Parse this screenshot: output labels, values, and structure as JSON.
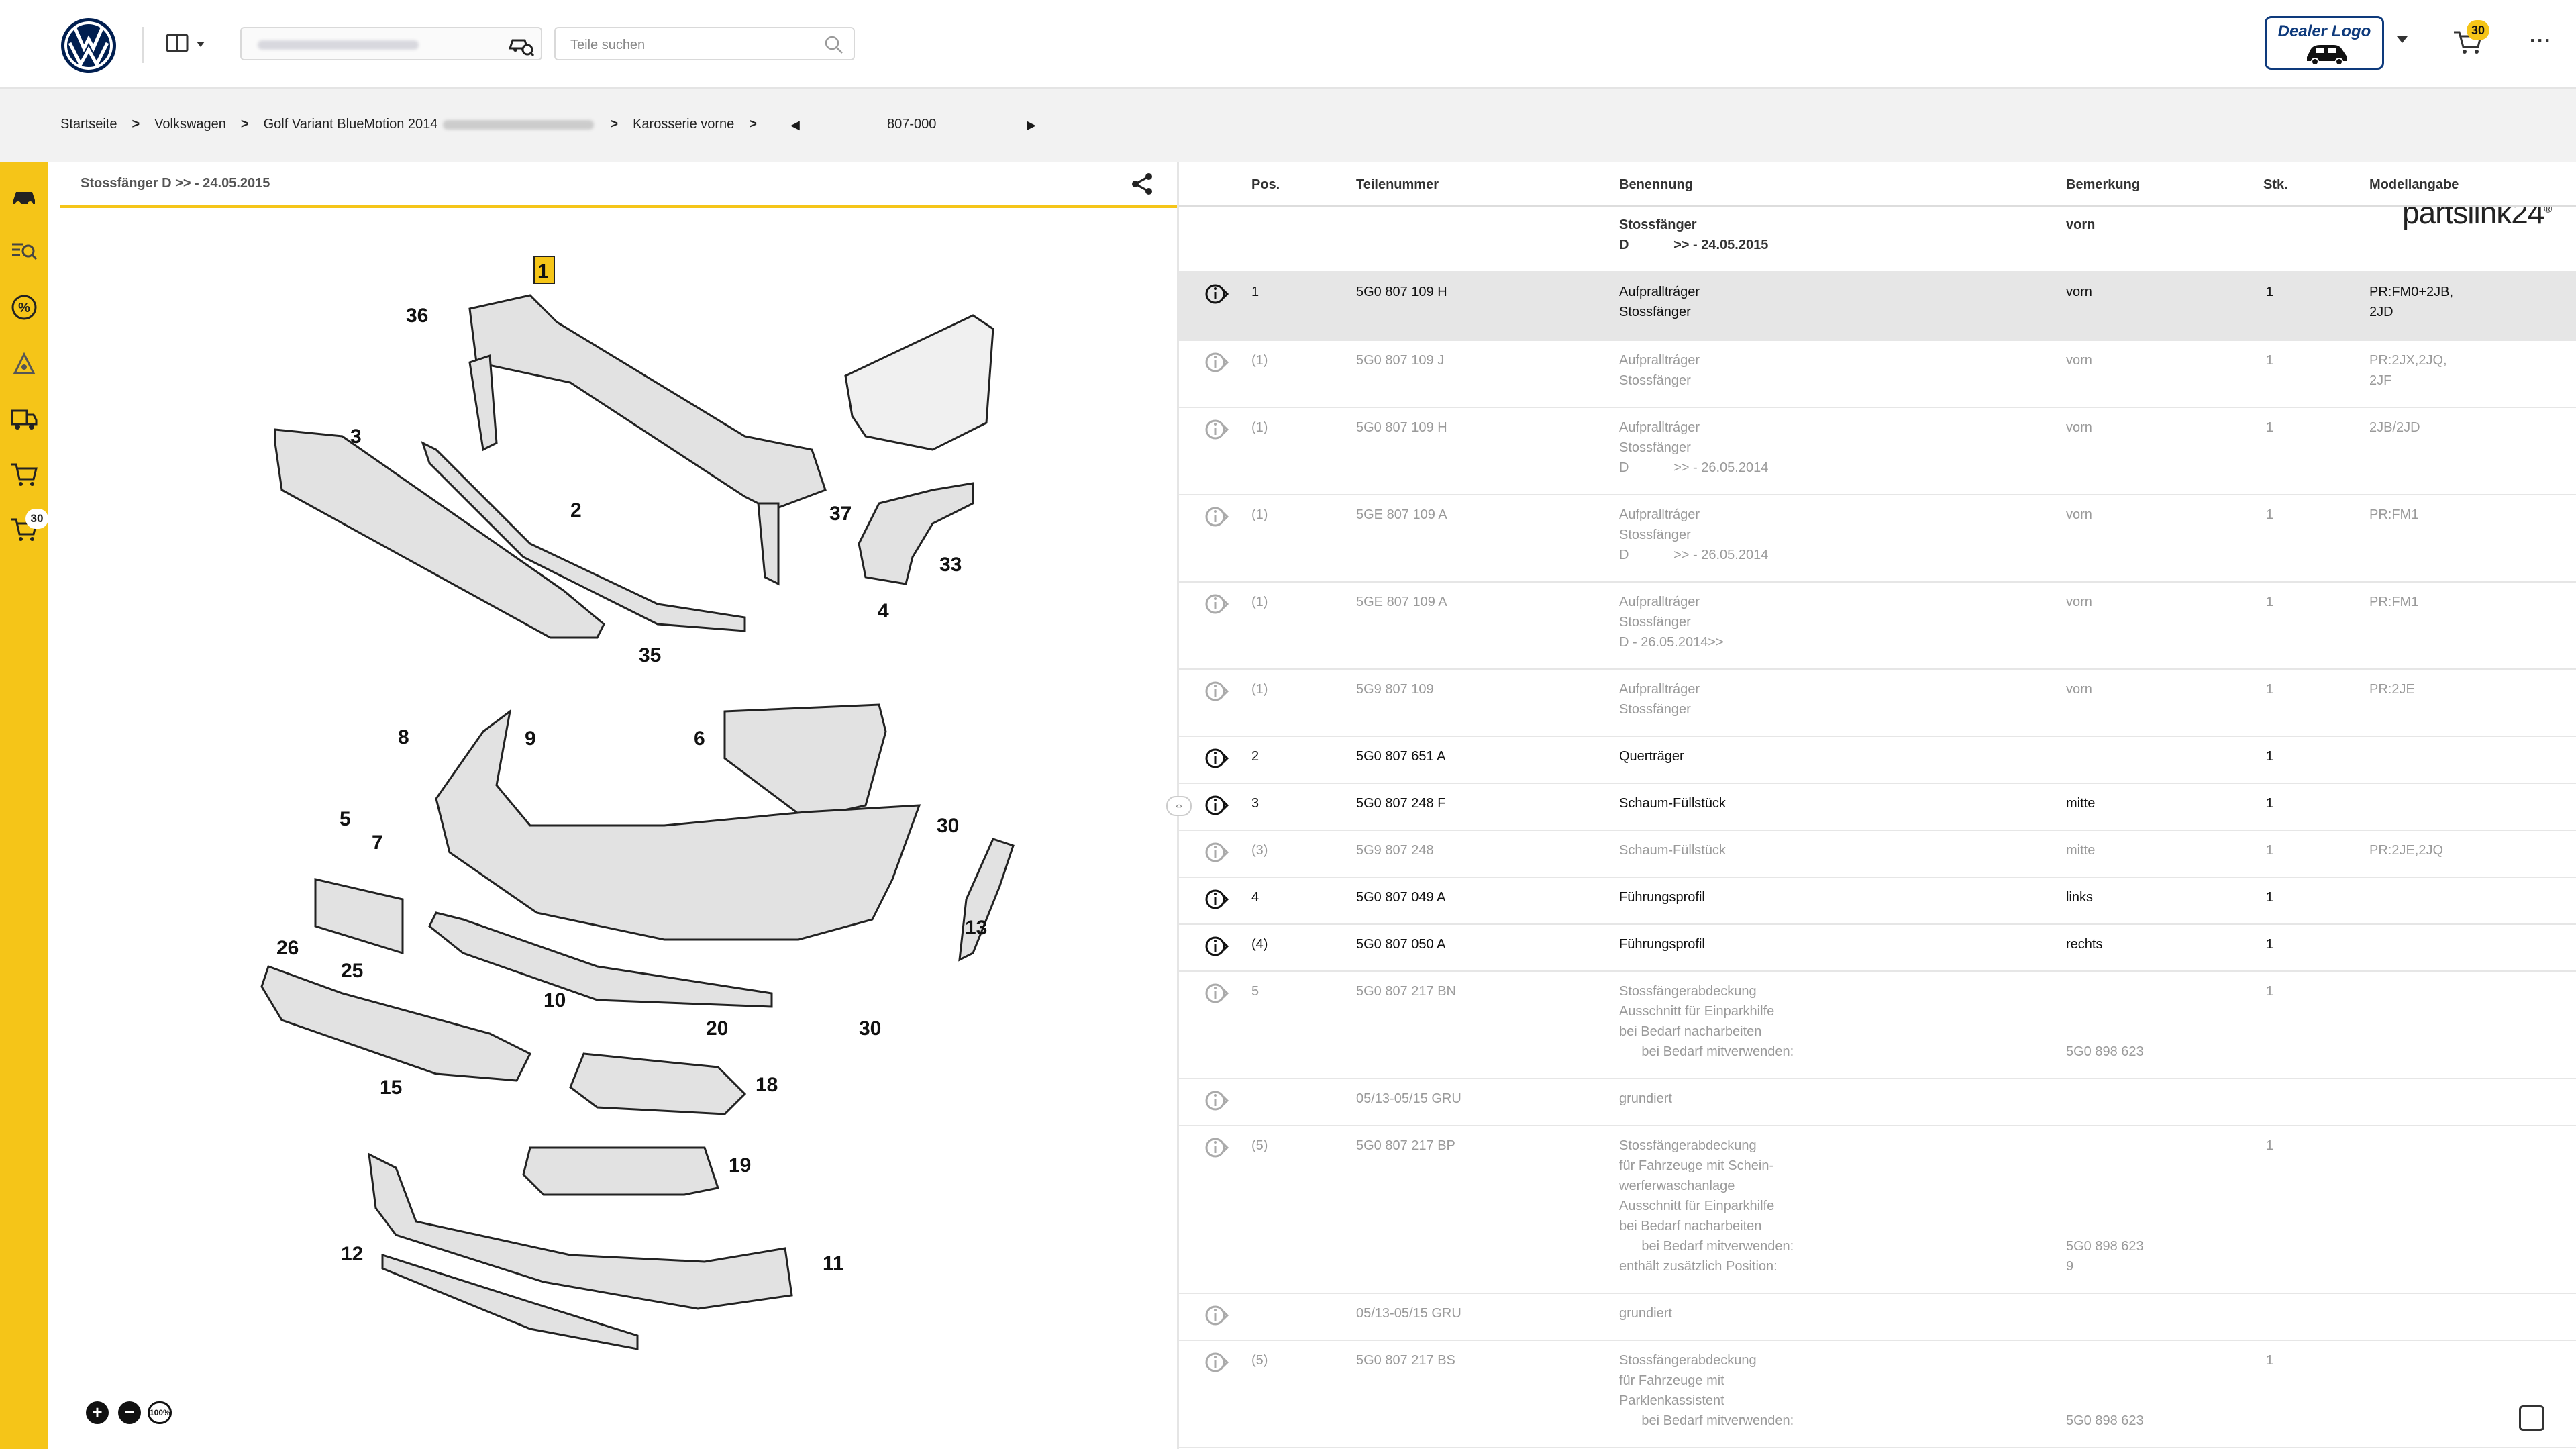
{
  "header": {
    "vin_placeholder": "",
    "search_placeholder": "Teile suchen",
    "dealer_logo_text": "Dealer Logo",
    "cart_count": "30",
    "more_label": "···"
  },
  "breadcrumb": {
    "items": [
      "Startseite",
      "Volkswagen",
      "Golf Variant BlueMotion 2014",
      "Karosserie vorne"
    ],
    "page_value": "807-000"
  },
  "brand": {
    "name": "partslink24",
    "reg": "®"
  },
  "sidebar": {
    "items": [
      "car-icon",
      "parts-search-icon",
      "percent-icon",
      "accessory-icon",
      "transport-icon",
      "cart-icon",
      "cart-badge-icon"
    ],
    "cart_badge": "30"
  },
  "drawing": {
    "title": "Stossfänger D >> - 24.05.2015",
    "zoom_in": "+",
    "zoom_out": "−",
    "zoom_reset": "100%",
    "callouts": [
      "1",
      "36",
      "3",
      "2",
      "37",
      "33",
      "4",
      "35",
      "8",
      "9",
      "6",
      "5",
      "7",
      "30",
      "26",
      "25",
      "10",
      "20",
      "30",
      "13",
      "15",
      "18",
      "19",
      "12",
      "11"
    ]
  },
  "table": {
    "headers": {
      "pos": "Pos.",
      "part": "Teilenummer",
      "name": "Benennung",
      "remark": "Bemerkung",
      "qty": "Stk.",
      "model": "Modellangabe"
    },
    "group": {
      "name": "Stossfänger\nD            >> - 24.05.2015",
      "remark": "vorn"
    },
    "rows": [
      {
        "pos": "1",
        "part": "5G0 807 109 H",
        "name": "Aufpralltráger\nStossfänger",
        "remark": "vorn",
        "qty": "1",
        "model": "PR:FM0+2JB,\n2JD",
        "state": "sel"
      },
      {
        "pos": "(1)",
        "part": "5G0 807 109 J",
        "name": "Aufpralltráger\nStossfänger",
        "remark": "vorn",
        "qty": "1",
        "model": "PR:2JX,2JQ,\n2JF",
        "state": "inact"
      },
      {
        "pos": "(1)",
        "part": "5G0 807 109 H",
        "name": "Aufpralltráger\nStossfänger\nD            >> - 26.05.2014",
        "remark": "vorn",
        "qty": "1",
        "model": "2JB/2JD",
        "state": "inact"
      },
      {
        "pos": "(1)",
        "part": "5GE 807 109 A",
        "name": "Aufpralltráger\nStossfänger\nD            >> - 26.05.2014",
        "remark": "vorn",
        "qty": "1",
        "model": "PR:FM1",
        "state": "inact"
      },
      {
        "pos": "(1)",
        "part": "5GE 807 109 A",
        "name": "Aufpralltráger\nStossfänger\nD - 26.05.2014>>",
        "remark": "vorn",
        "qty": "1",
        "model": "PR:FM1",
        "state": "inact"
      },
      {
        "pos": "(1)",
        "part": "5G9 807 109",
        "name": "Aufpralltráger\nStossfänger",
        "remark": "vorn",
        "qty": "1",
        "model": "PR:2JE",
        "state": "inact"
      },
      {
        "pos": "2",
        "part": "5G0 807 651 A",
        "name": "Querträger",
        "remark": "",
        "qty": "1",
        "model": "",
        "state": "act"
      },
      {
        "pos": "3",
        "part": "5G0 807 248 F",
        "name": "Schaum-Füllstück",
        "remark": "mitte",
        "qty": "1",
        "model": "",
        "state": "act"
      },
      {
        "pos": "(3)",
        "part": "5G9 807 248",
        "name": "Schaum-Füllstück",
        "remark": "mitte",
        "qty": "1",
        "model": "PR:2JE,2JQ",
        "state": "inact"
      },
      {
        "pos": "4",
        "part": "5G0 807 049 A",
        "name": "Führungsprofil",
        "remark": "links",
        "qty": "1",
        "model": "",
        "state": "act"
      },
      {
        "pos": "(4)",
        "part": "5G0 807 050 A",
        "name": "Führungsprofil",
        "remark": "rechts",
        "qty": "1",
        "model": "",
        "state": "act"
      },
      {
        "pos": "5",
        "part": "5G0 807 217 BN",
        "name": "Stossfängerabdeckung\nAusschnitt für Einparkhilfe\nbei Bedarf nacharbeiten\n      bei Bedarf mitverwenden:",
        "remark": "\n\n\n5G0 898 623",
        "qty": "1",
        "model": "",
        "state": "inact"
      },
      {
        "pos": "",
        "part": "05/13-05/15 GRU",
        "name": "grundiert",
        "remark": "",
        "qty": "",
        "model": "",
        "state": "inact"
      },
      {
        "pos": "(5)",
        "part": "5G0 807 217 BP",
        "name": "Stossfängerabdeckung\nfür Fahrzeuge mit Schein-\nwerferwaschanlage\nAusschnitt für Einparkhilfe\nbei Bedarf nacharbeiten\n      bei Bedarf mitverwenden:\nenthält zusätzlich Position:",
        "remark": "\n\n\n\n\n5G0 898 623\n9",
        "qty": "1",
        "model": "",
        "state": "inact"
      },
      {
        "pos": "",
        "part": "05/13-05/15 GRU",
        "name": "grundiert",
        "remark": "",
        "qty": "",
        "model": "",
        "state": "inact"
      },
      {
        "pos": "(5)",
        "part": "5G0 807 217 BS",
        "name": "Stossfängerabdeckung\nfür Fahrzeuge mit\nParklenkassistent\n      bei Bedarf mitverwenden:",
        "remark": "\n\n\n5G0 898 623",
        "qty": "1",
        "model": "",
        "state": "inact"
      }
    ]
  },
  "colors": {
    "accent": "#f5c518",
    "vw_blue": "#001e50",
    "dealer_blue": "#0e3a7c"
  }
}
